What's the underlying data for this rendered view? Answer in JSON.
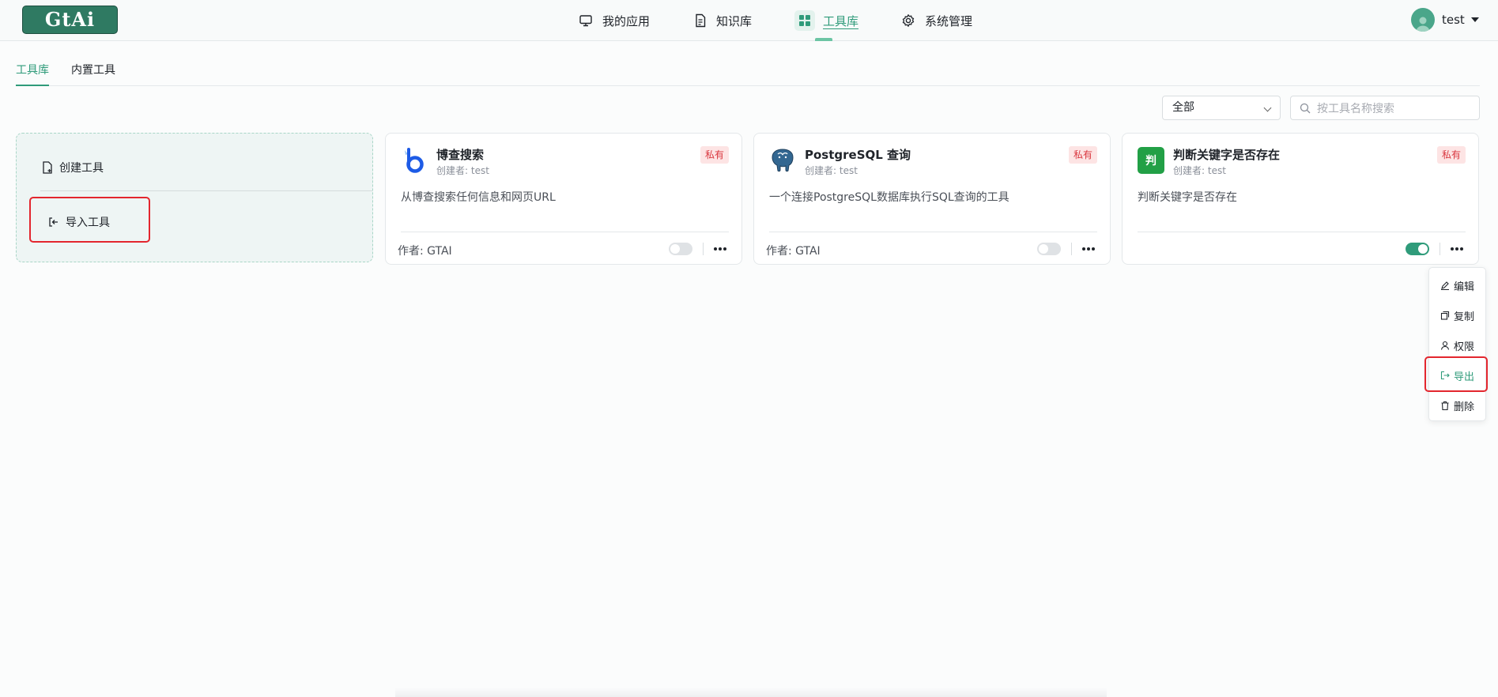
{
  "app": {
    "logo_text": "GtAi"
  },
  "nav": {
    "items": [
      {
        "label": "我的应用",
        "icon": "monitor-icon"
      },
      {
        "label": "知识库",
        "icon": "document-icon"
      },
      {
        "label": "工具库",
        "icon": "grid-icon",
        "active": true
      },
      {
        "label": "系统管理",
        "icon": "gear-icon"
      }
    ]
  },
  "user": {
    "name": "test"
  },
  "subtabs": [
    {
      "label": "工具库",
      "active": true
    },
    {
      "label": "内置工具",
      "active": false
    }
  ],
  "filter": {
    "selected": "全部"
  },
  "search": {
    "placeholder": "按工具名称搜索"
  },
  "create_card": {
    "create_label": "创建工具",
    "import_label": "导入工具"
  },
  "tools": [
    {
      "title": "博查搜索",
      "creator": "创建者: test",
      "badge": "私有",
      "desc": "从博查搜索任何信息和网页URL",
      "author": "作者: GTAI",
      "enabled": false,
      "icon": "bocha-logo-icon"
    },
    {
      "title": "PostgreSQL 查询",
      "creator": "创建者: test",
      "badge": "私有",
      "desc": "一个连接PostgreSQL数据库执行SQL查询的工具",
      "author": "作者: GTAI",
      "enabled": false,
      "icon": "postgresql-elephant-icon"
    },
    {
      "title": "判断关键字是否存在",
      "creator": "创建者: test",
      "badge": "私有",
      "desc": "判断关键字是否存在",
      "author": "",
      "enabled": true,
      "icon": "pan-char-icon",
      "icon_char": "判"
    }
  ],
  "context_menu": {
    "items": [
      {
        "label": "编辑",
        "icon": "edit-icon"
      },
      {
        "label": "复制",
        "icon": "copy-icon"
      },
      {
        "label": "权限",
        "icon": "user-icon"
      },
      {
        "label": "导出",
        "icon": "export-icon",
        "highlighted": true
      },
      {
        "label": "删除",
        "icon": "trash-icon"
      }
    ]
  },
  "colors": {
    "accent": "#2f9b7a",
    "logo_bg": "#2f7a62",
    "badge_bg": "#fde4e4",
    "badge_text": "#d9363e",
    "highlight_box": "#e3262e"
  }
}
